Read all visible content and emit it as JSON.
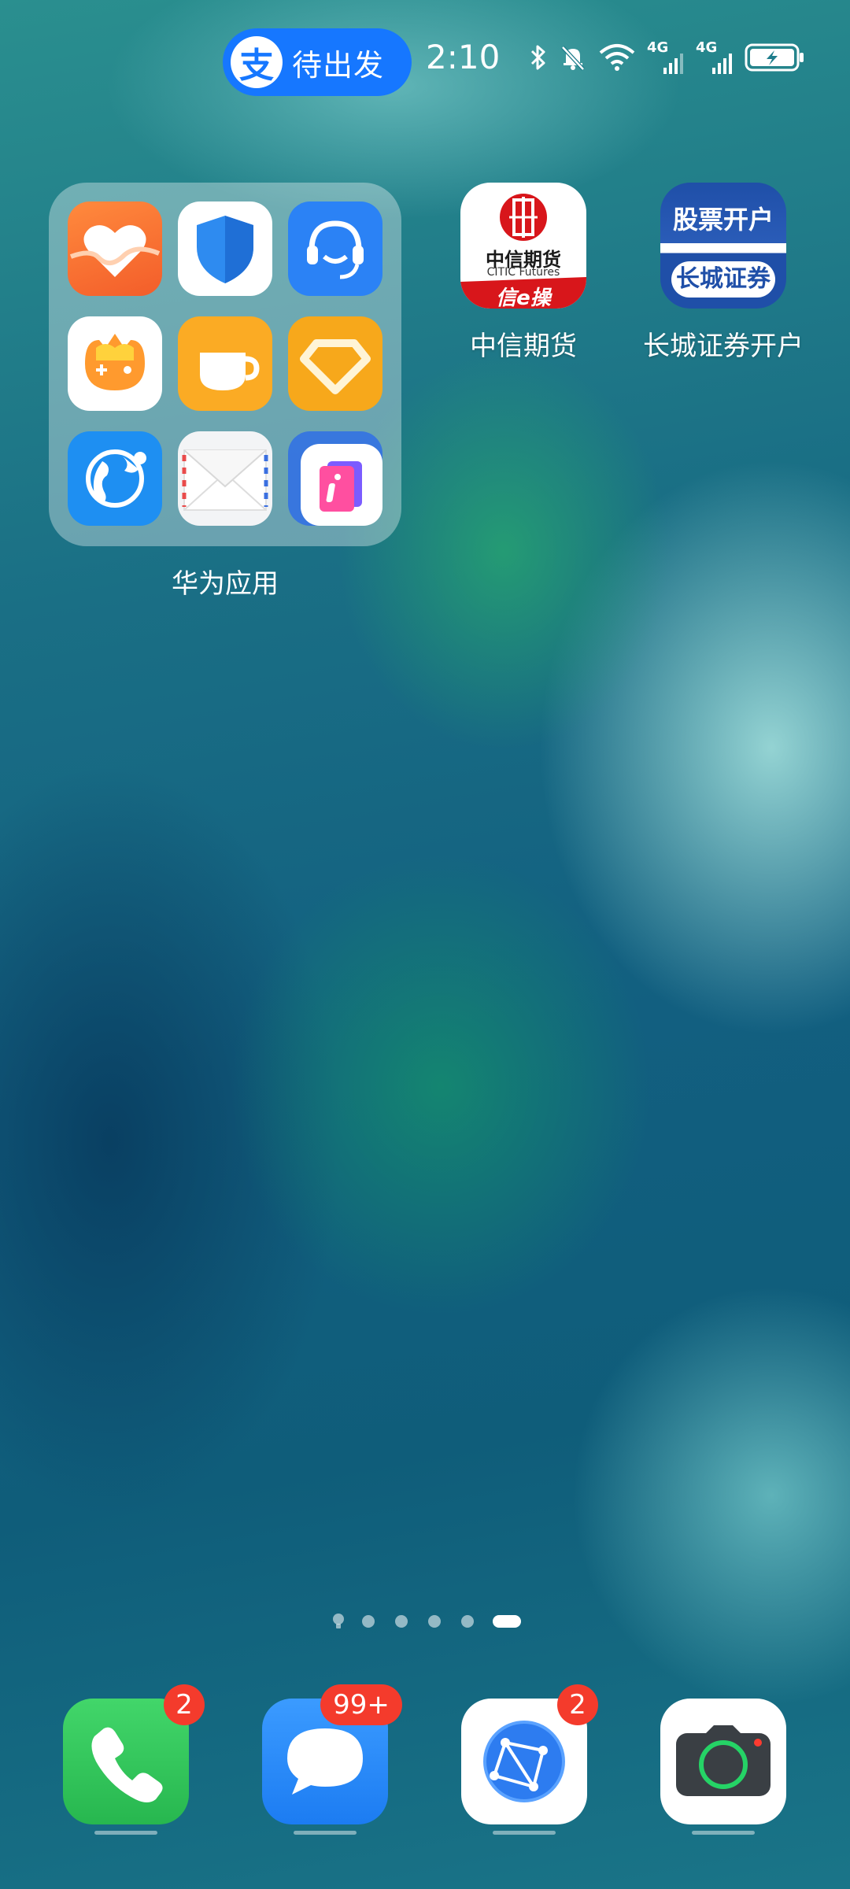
{
  "status_bar": {
    "pill_icon_char": "支",
    "pill_text": "待出发",
    "time": "2:10",
    "network_1": "4G",
    "network_2": "4G",
    "icons": [
      "bluetooth-icon",
      "mute-bell-icon",
      "wifi-icon",
      "signal-icon",
      "signal-icon",
      "battery-charging-icon"
    ]
  },
  "folder": {
    "label": "华为应用",
    "apps": [
      "health-icon",
      "phone-manager-icon",
      "customer-service-icon",
      "game-center-icon",
      "coffee-app-icon",
      "huawei-store-icon",
      "browser-globe-icon",
      "email-icon",
      "tips-icon"
    ]
  },
  "apps": [
    {
      "label": "中信期货",
      "icon_line1": "中信期货",
      "icon_line2": "CITIC Futures",
      "icon_line3": "信e操"
    },
    {
      "label": "长城证券开户",
      "icon_line1": "股票开户",
      "icon_line2": "长城证券"
    }
  ],
  "page_indicator": {
    "count": 6,
    "active_index": 5
  },
  "dock": [
    {
      "name": "phone",
      "badge": "2",
      "color": "#34c759"
    },
    {
      "name": "messages",
      "badge": "99+",
      "color": "#2b8cff"
    },
    {
      "name": "browser",
      "badge": "2",
      "color": "#ffffff"
    },
    {
      "name": "camera",
      "badge": "",
      "color": "#ffffff"
    }
  ]
}
